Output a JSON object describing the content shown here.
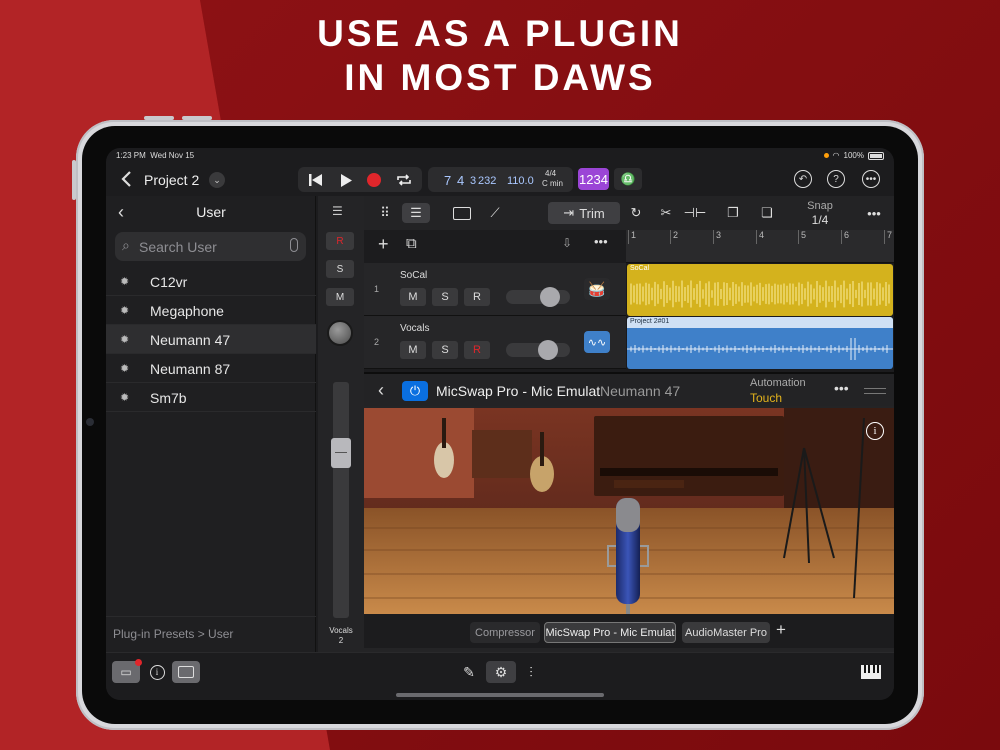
{
  "headline": {
    "line1": "USE AS A PLUGIN",
    "line2": "IN MOST DAWS"
  },
  "status_bar": {
    "time": "1:23 PM",
    "date": "Wed Nov 15",
    "battery": "100%"
  },
  "project": {
    "title": "Project 2"
  },
  "lcd": {
    "bar": "7",
    "beat": "4",
    "subdivision": "3",
    "tick": "232",
    "tempo": "110.0",
    "time_sig": "4/4",
    "key": "C min"
  },
  "count_in": "1234",
  "browser": {
    "title": "User",
    "search_placeholder": "Search User",
    "presets": [
      "C12vr",
      "Megaphone",
      "Neumann 47",
      "Neumann 87",
      "Sm7b"
    ],
    "selected_preset": "Neumann 47",
    "footer": "Plug-in Presets > User"
  },
  "strip": {
    "r": "R",
    "s": "S",
    "m": "M",
    "name": "Vocals",
    "number": "2"
  },
  "toolbar": {
    "trim": "Trim",
    "snap_label": "Snap",
    "snap_value": "1/4"
  },
  "ruler": [
    "1",
    "2",
    "3",
    "4",
    "5",
    "6",
    "7"
  ],
  "tracks": [
    {
      "num": "1",
      "name": "SoCal",
      "region": "SoCal",
      "m": "M",
      "s": "S",
      "r": "R",
      "color": "#d4b21d"
    },
    {
      "num": "2",
      "name": "Vocals",
      "region": "Project 2#01",
      "m": "M",
      "s": "S",
      "r": "R",
      "color": "#3f80c9"
    }
  ],
  "plugin": {
    "title": "MicSwap Pro - Mic Emulat",
    "preset": "Neumann 47",
    "automation_label": "Automation",
    "automation_mode": "Touch"
  },
  "plugin_tabs": [
    "Compressor",
    "MicSwap Pro - Mic Emulat",
    "AudioMaster Pro"
  ],
  "colors": {
    "accent_blue": "#0a6fe0",
    "record_red": "#e0262b",
    "count_in_purple": "#9b45d6",
    "automation_yellow": "#e3b31c"
  }
}
